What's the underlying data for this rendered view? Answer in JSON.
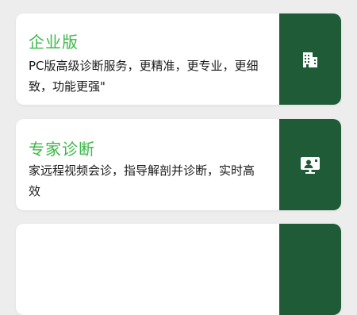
{
  "theme": {
    "accent": "#3cb849",
    "sidebar_bg": "#1e5b36",
    "page_bg": "#ededed",
    "card_bg": "#ffffff"
  },
  "cards": [
    {
      "title": "企业版",
      "description": "PC版高级诊断服务，更精准，更专业，更细致，功能更强\"",
      "icon": "building-icon"
    },
    {
      "title": "专家诊断",
      "description": "家远程视频会诊，指导解剖并诊断，实时高效",
      "icon": "video-consult-icon"
    },
    {
      "title": "",
      "description": "",
      "icon": ""
    }
  ]
}
